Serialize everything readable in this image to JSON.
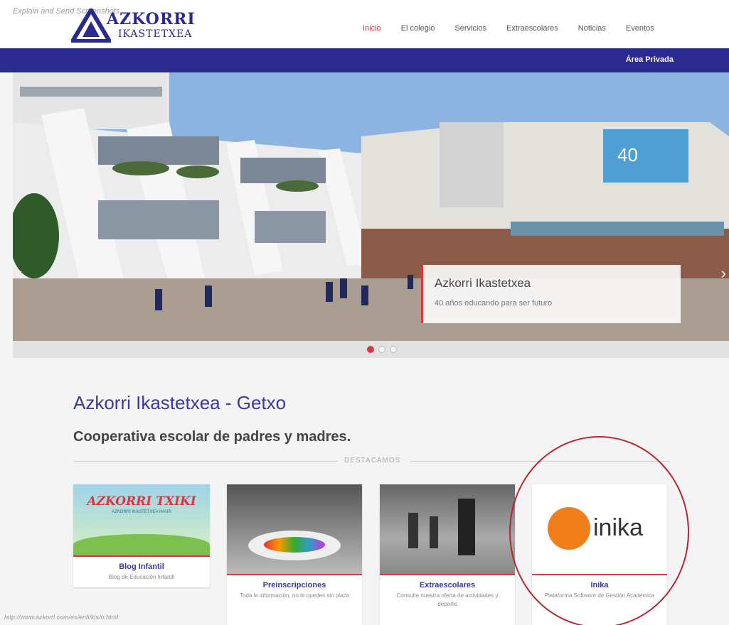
{
  "watermark": "Explain and Send Screenshots",
  "logo": {
    "line1": "AZKORRI",
    "line2": "IKASTETXEA"
  },
  "nav": {
    "items": [
      {
        "label": "Inicio",
        "active": true
      },
      {
        "label": "El colegio"
      },
      {
        "label": "Servicios"
      },
      {
        "label": "Extraescolares"
      },
      {
        "label": "Noticias"
      },
      {
        "label": "Eventos"
      }
    ],
    "private_area": "Área Privada"
  },
  "colors": {
    "brand": "#2b2a8f",
    "accent": "#e0353d",
    "circle": "#b8262e",
    "inika_orange": "#f07f1b"
  },
  "slider": {
    "caption_title": "Azkorri Ikastetxea",
    "caption_subtitle": "40 años educando para ser futuro",
    "banner_text": "40",
    "prev_icon": "chevron-left-icon",
    "next_icon": "chevron-right-icon",
    "dots": 3,
    "active_dot": 0
  },
  "main": {
    "title": "Azkorri Ikastetxea - Getxo",
    "subtitle": "Cooperativa escolar de padres y madres.",
    "section_label": "DESTACAMOS"
  },
  "cards": [
    {
      "title": "Blog Infantil",
      "description": "Blog de Educación Infantil",
      "image_text": "AZKORRI TXIKI",
      "image_subtext": "AZKORRI IKASTETXEA HAUR"
    },
    {
      "title": "Preinscripciones",
      "description": "Toda la información, no te quedes sin plaza"
    },
    {
      "title": "Extraescolares",
      "description": "Consulte nuestra oferta de actividades y deporte"
    },
    {
      "title": "Inika",
      "description": "Plataforma Software de Gestión Académica",
      "logo_text": "inika"
    }
  ],
  "status_url": "http://www.azkorri.com/es/enfi/kis/o.html"
}
